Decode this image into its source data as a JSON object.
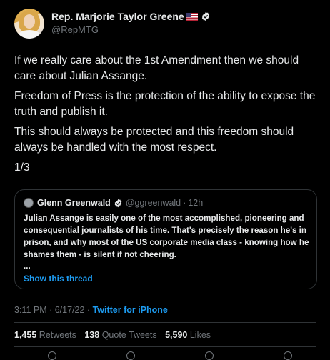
{
  "author": {
    "display_name": "Rep. Marjorie Taylor Greene",
    "handle": "@RepMTG"
  },
  "tweet": {
    "paragraphs": [
      "If we really care about the 1st Amendment then we should care about Julian Assange.",
      "Freedom of Press is the protection of the ability to expose the truth and publish it.",
      "This should always be protected and this freedom should always be handled with the most respect.",
      "1/3"
    ]
  },
  "quote": {
    "name": "Glenn Greenwald",
    "handle": "@ggreenwald",
    "sep": "·",
    "time": "12h",
    "text": "Julian Assange is easily one of the most accomplished, pioneering and consequential journalists of his time. That's precisely the reason he's in prison, and why most of the US corporate media class - knowing how he shames them - is silent if not cheering.",
    "ellipsis": "...",
    "show_thread": "Show this thread"
  },
  "meta": {
    "time": "3:11 PM",
    "date": "6/17/22",
    "sep": " · ",
    "client": "Twitter for iPhone"
  },
  "stats": {
    "retweets_count": "1,455",
    "retweets_label": "Retweets",
    "quotes_count": "138",
    "quotes_label": "Quote Tweets",
    "likes_count": "5,590",
    "likes_label": "Likes"
  },
  "colors": {
    "accent": "#1d9bf0",
    "background": "#000000",
    "secondary_text": "#71767b"
  }
}
